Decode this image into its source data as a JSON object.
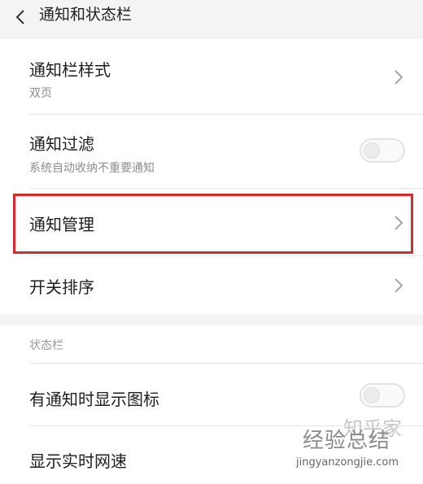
{
  "header": {
    "title": "通知和状态栏",
    "back_icon": "back-arrow-icon"
  },
  "notification_settings": {
    "style": {
      "title": "通知栏样式",
      "value": "双页"
    },
    "filter": {
      "title": "通知过滤",
      "subtitle": "系统自动收纳不重要通知",
      "enabled": false
    },
    "management": {
      "title": "通知管理",
      "highlighted": true
    },
    "sort": {
      "title": "开关排序"
    }
  },
  "status_bar": {
    "section_label": "状态栏",
    "show_icon": {
      "title": "有通知时显示图标",
      "enabled": false
    },
    "network_speed": {
      "title": "显示实时网速"
    }
  },
  "watermark": {
    "ghost_text": "知乎家",
    "main_text": "经验总结",
    "url": "jingyanzongjie.com"
  },
  "colors": {
    "highlight": "#d22b30",
    "background": "#f4f4f4",
    "card": "#ffffff"
  }
}
